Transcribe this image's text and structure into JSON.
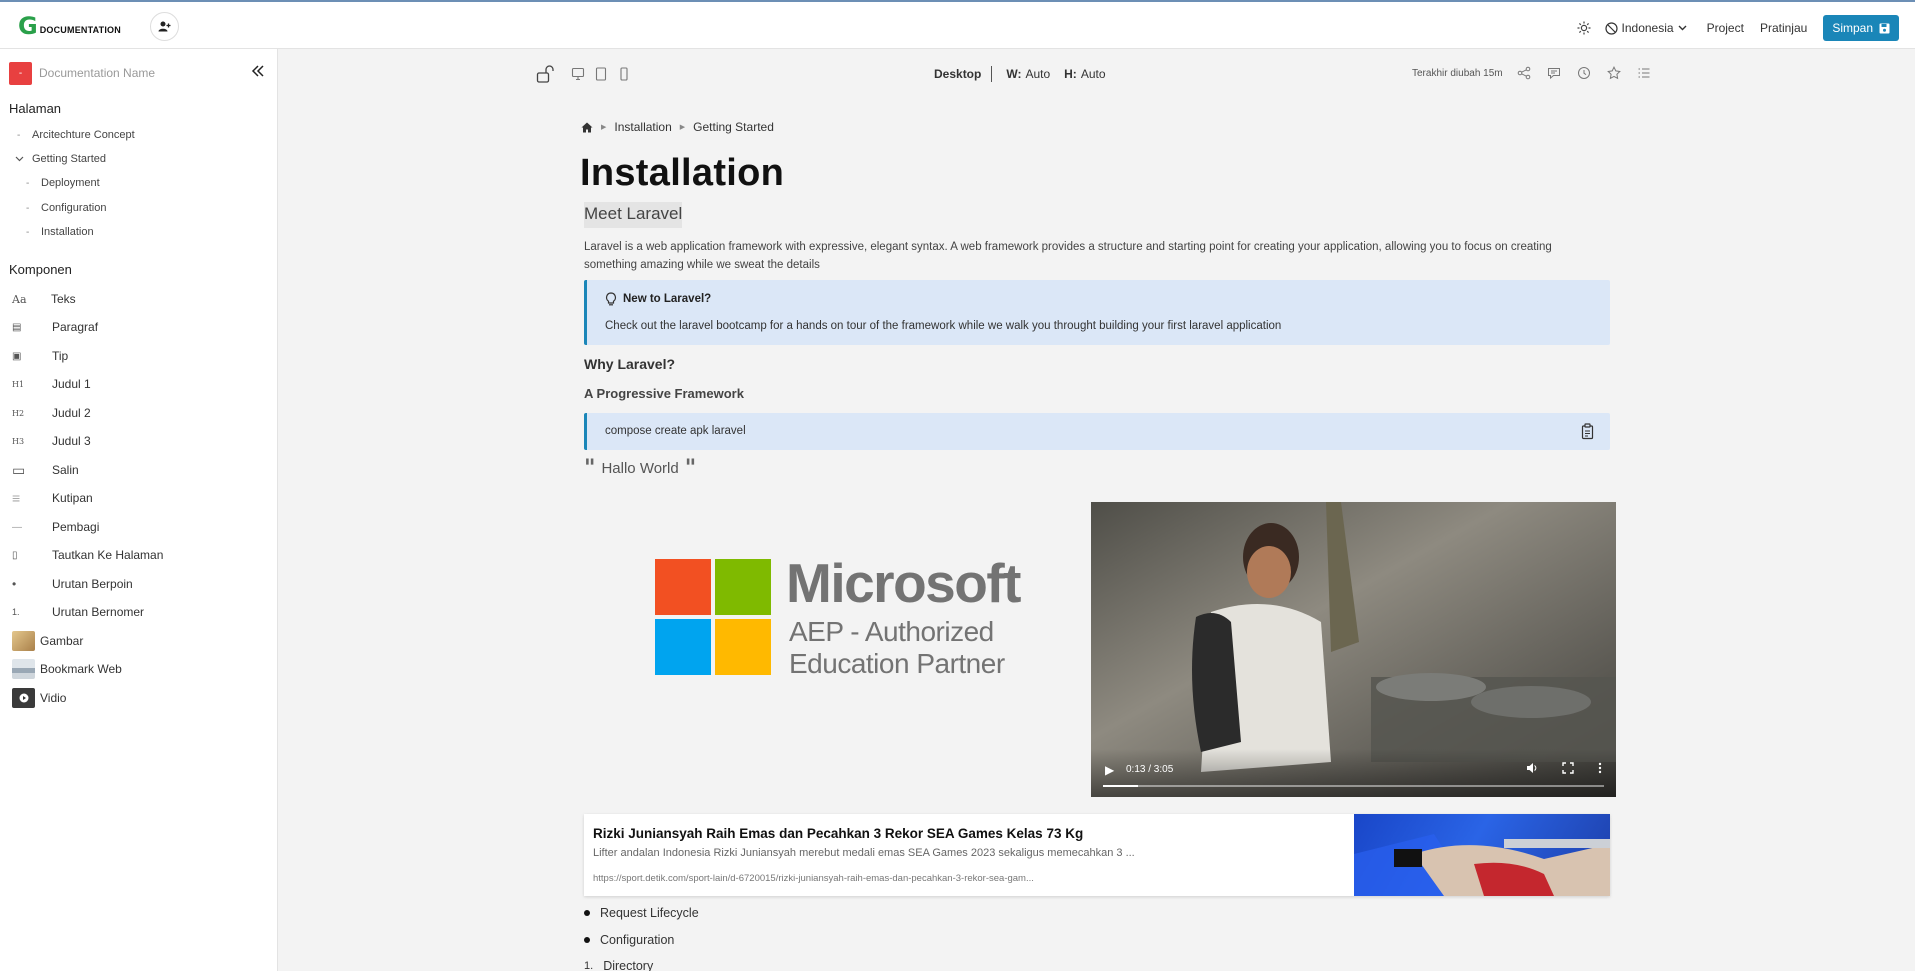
{
  "app": {
    "logo_letter": "G",
    "logo_text": "DOCUMENTATION"
  },
  "topbar": {
    "language": "Indonesia",
    "project": "Project",
    "preview": "Pratinjau",
    "save": "Simpan"
  },
  "sidebar": {
    "doc_name_placeholder": "Documentation Name",
    "doc_icon_text": "-",
    "pages_title": "Halaman",
    "pages": [
      {
        "label": "Arcitechture Concept",
        "marker": "-"
      },
      {
        "label": "Getting Started",
        "marker": "⌄"
      },
      {
        "label": "Deployment",
        "marker": "-"
      },
      {
        "label": "Configuration",
        "marker": "-"
      },
      {
        "label": "Installation",
        "marker": "-"
      }
    ],
    "components_title": "Komponen",
    "components": [
      {
        "label": "Teks",
        "icon": "text-icon",
        "glyph": "Aa"
      },
      {
        "label": "Paragraf",
        "icon": "paragraph-icon",
        "glyph": "▤"
      },
      {
        "label": "Tip",
        "icon": "tip-icon",
        "glyph": "▣"
      },
      {
        "label": "Judul 1",
        "icon": "heading1-icon",
        "glyph": "H1"
      },
      {
        "label": "Judul 2",
        "icon": "heading2-icon",
        "glyph": "H2"
      },
      {
        "label": "Judul 3",
        "icon": "heading3-icon",
        "glyph": "H3"
      },
      {
        "label": "Salin",
        "icon": "copy-block-icon",
        "glyph": "▭"
      },
      {
        "label": "Kutipan",
        "icon": "quote-icon",
        "glyph": "≡"
      },
      {
        "label": "Pembagi",
        "icon": "divider-icon",
        "glyph": "—"
      },
      {
        "label": "Tautkan Ke Halaman",
        "icon": "link-page-icon",
        "glyph": "▯"
      },
      {
        "label": "Urutan Berpoin",
        "icon": "bullet-list-icon",
        "glyph": "•"
      },
      {
        "label": "Urutan Bernomer",
        "icon": "numbered-list-icon",
        "glyph": "1."
      },
      {
        "label": "Gambar",
        "icon": "image-icon",
        "glyph": ""
      },
      {
        "label": "Bookmark Web",
        "icon": "bookmark-icon",
        "glyph": ""
      },
      {
        "label": "Vidio",
        "icon": "video-icon",
        "glyph": ""
      }
    ]
  },
  "toolbar": {
    "device": "Desktop",
    "width_label": "W:",
    "width_value": "Auto",
    "height_label": "H:",
    "height_value": "Auto",
    "last_modified": "Terakhir diubah 15m"
  },
  "content": {
    "breadcrumb": [
      "Installation",
      "Getting Started"
    ],
    "title": "Installation",
    "subtitle": "Meet Laravel",
    "paragraph": "Laravel is a web application framework with expressive, elegant syntax. A web framework provides a structure and starting point for creating your application, allowing you to focus on creating something amazing while we sweat the details",
    "tip_title": "New to Laravel?",
    "tip_text": "Check out the laravel bootcamp for a hands on tour of the framework while we walk  you throught building your first laravel application",
    "heading2": "Why Laravel?",
    "heading3": "A Progressive Framework",
    "code": "compose create apk laravel",
    "quote": "Hallo World",
    "image": {
      "brand": "Microsoft",
      "line1": "AEP - Authorized",
      "line2": "Education Partner",
      "colors": [
        "#f25022",
        "#7fba00",
        "#00a4ef",
        "#ffb900"
      ]
    },
    "video": {
      "time": "0:13 / 3:05",
      "progress": 0.07
    },
    "bookmark": {
      "title": "Rizki Juniansyah Raih Emas dan Pecahkan 3 Rekor SEA Games Kelas 73 Kg",
      "description": "Lifter andalan Indonesia Rizki Juniansyah merebut medali emas SEA Games 2023 sekaligus memecahkan 3 ...",
      "url": "https://sport.detik.com/sport-lain/d-6720015/rizki-juniansyah-raih-emas-dan-pecahkan-3-rekor-sea-gam..."
    },
    "bullets": [
      "Request Lifecycle",
      "Configuration"
    ],
    "numbered": [
      {
        "num": "1.",
        "label": "Directory"
      }
    ]
  },
  "colors": {
    "accent": "#1a86b8",
    "logo_green": "#2aa04a",
    "doc_icon": "#e84040",
    "tip_bg": "#dbe7f7"
  }
}
